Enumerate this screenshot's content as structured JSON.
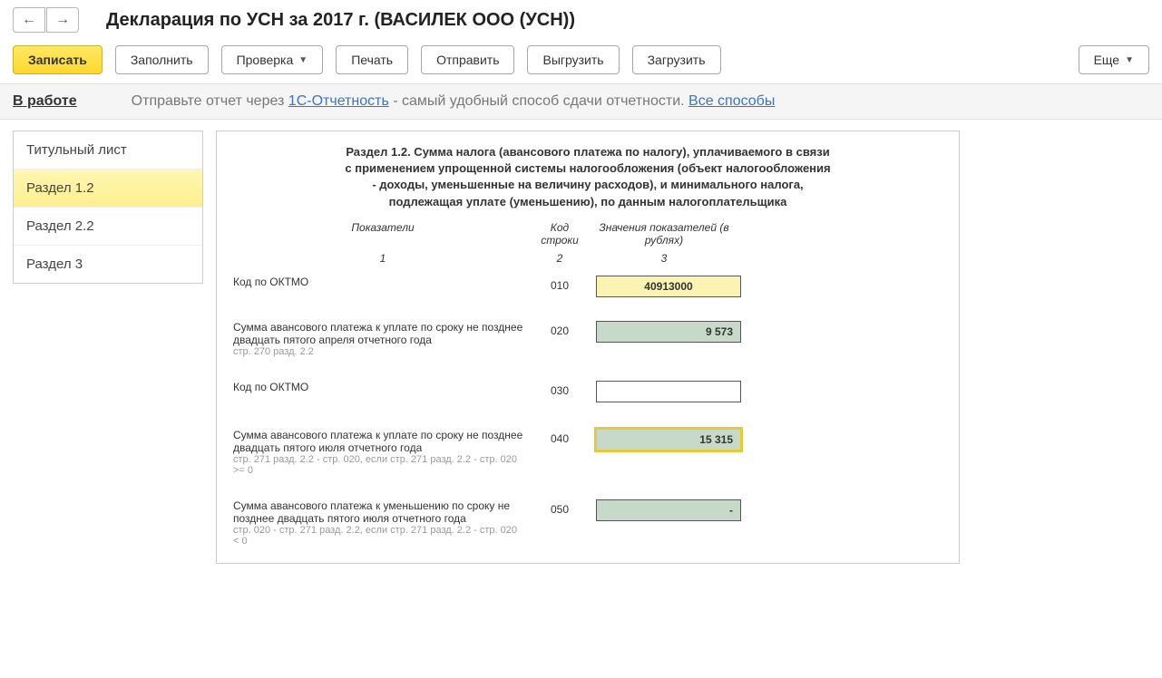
{
  "nav": {
    "back": "←",
    "forward": "→"
  },
  "pageTitle": "Декларация по УСН за 2017 г. (ВАСИЛЕК ООО (УСН))",
  "toolbar": {
    "record": "Записать",
    "fill": "Заполнить",
    "check": "Проверка",
    "print": "Печать",
    "send": "Отправить",
    "export": "Выгрузить",
    "import": "Загрузить",
    "more": "Еще"
  },
  "status": {
    "stage": "В работе",
    "hint_pre": "Отправьте отчет через ",
    "hint_link1": "1С-Отчетность",
    "hint_mid": " - самый удобный способ сдачи отчетности. ",
    "hint_link2": "Все способы"
  },
  "tabs": {
    "t0": "Титульный лист",
    "t1": "Раздел 1.2",
    "t2": "Раздел 2.2",
    "t3": "Раздел 3"
  },
  "section": {
    "title": "Раздел 1.2. Сумма налога (авансового платежа по налогу), уплачиваемого в связи с применением упрощенной системы налогообложения (объект налогообложения - доходы, уменьшенные на величину расходов), и минимального налога, подлежащая уплате (уменьшению), по данным налогоплательщика",
    "headers": {
      "h1": "Показатели",
      "h2": "Код строки",
      "h3": "Значения показателей (в рублях)",
      "n1": "1",
      "n2": "2",
      "n3": "3"
    },
    "rows": [
      {
        "label": "Код по ОКТМО",
        "sub": "",
        "code": "010",
        "value": "40913000",
        "style": "yellow"
      },
      {
        "label": "Сумма авансового платежа к уплате по сроку не позднее двадцать пятого апреля отчетного года",
        "sub": "стр. 270 разд. 2.2",
        "code": "020",
        "value": "9 573",
        "style": "green"
      },
      {
        "label": "Код по ОКТМО",
        "sub": "",
        "code": "030",
        "value": "",
        "style": "white"
      },
      {
        "label": "Сумма  авансового платежа к уплате по сроку не позднее двадцать пятого июля отчетного года",
        "sub": "стр. 271 разд. 2.2 - стр. 020, если стр. 271 разд. 2.2 - стр. 020 >= 0",
        "code": "040",
        "value": "15 315",
        "style": "green selected"
      },
      {
        "label": "Сумма авансового платежа к уменьшению по сроку не позднее двадцать пятого июля отчетного года",
        "sub": "стр. 020 - стр. 271 разд. 2.2, если стр. 271 разд. 2.2 - стр. 020 < 0",
        "code": "050",
        "value": "-",
        "style": "green"
      }
    ]
  }
}
